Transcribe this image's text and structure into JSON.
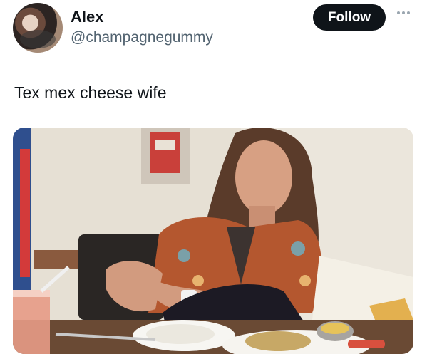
{
  "author": {
    "display_name": "Alex",
    "handle": "@champagnegummy",
    "avatar_icon": "profile-photo"
  },
  "actions": {
    "follow_label": "Follow",
    "more_icon": "more-dots-icon"
  },
  "tweet": {
    "text": "Tex mex cheese wife"
  },
  "media": {
    "type": "photo",
    "description_icon": "photo-image"
  },
  "colors": {
    "follow_bg": "#0f1419",
    "text_primary": "#0f1419",
    "text_secondary": "#536471"
  }
}
